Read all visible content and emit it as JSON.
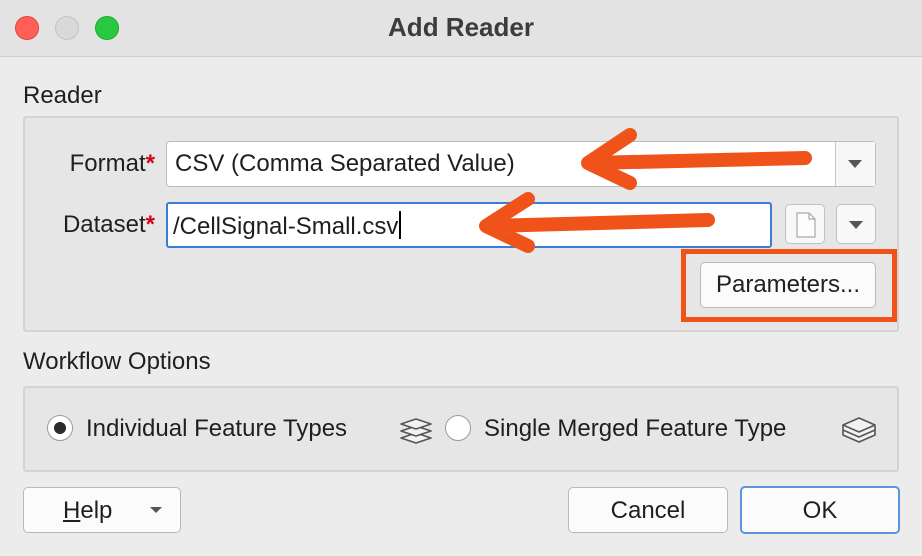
{
  "window": {
    "title": "Add Reader"
  },
  "reader": {
    "section_label": "Reader",
    "format": {
      "label": "Format",
      "required_mark": "*",
      "value": "CSV (Comma Separated Value)"
    },
    "dataset": {
      "label": "Dataset",
      "required_mark": "*",
      "value": "/CellSignal-Small.csv"
    },
    "parameters_button": "Parameters..."
  },
  "workflow": {
    "section_label": "Workflow Options",
    "options": [
      {
        "label": "Individual Feature Types",
        "selected": true,
        "icon": "layers-stack-icon"
      },
      {
        "label": "Single Merged Feature Type",
        "selected": false,
        "icon": "merged-layer-icon"
      }
    ]
  },
  "footer": {
    "help_underline": "H",
    "help_rest": "elp",
    "cancel": "Cancel",
    "ok": "OK"
  },
  "colors": {
    "annotation": "#f0531a",
    "focus": "#3d7bd8",
    "required": "#d0021b"
  }
}
